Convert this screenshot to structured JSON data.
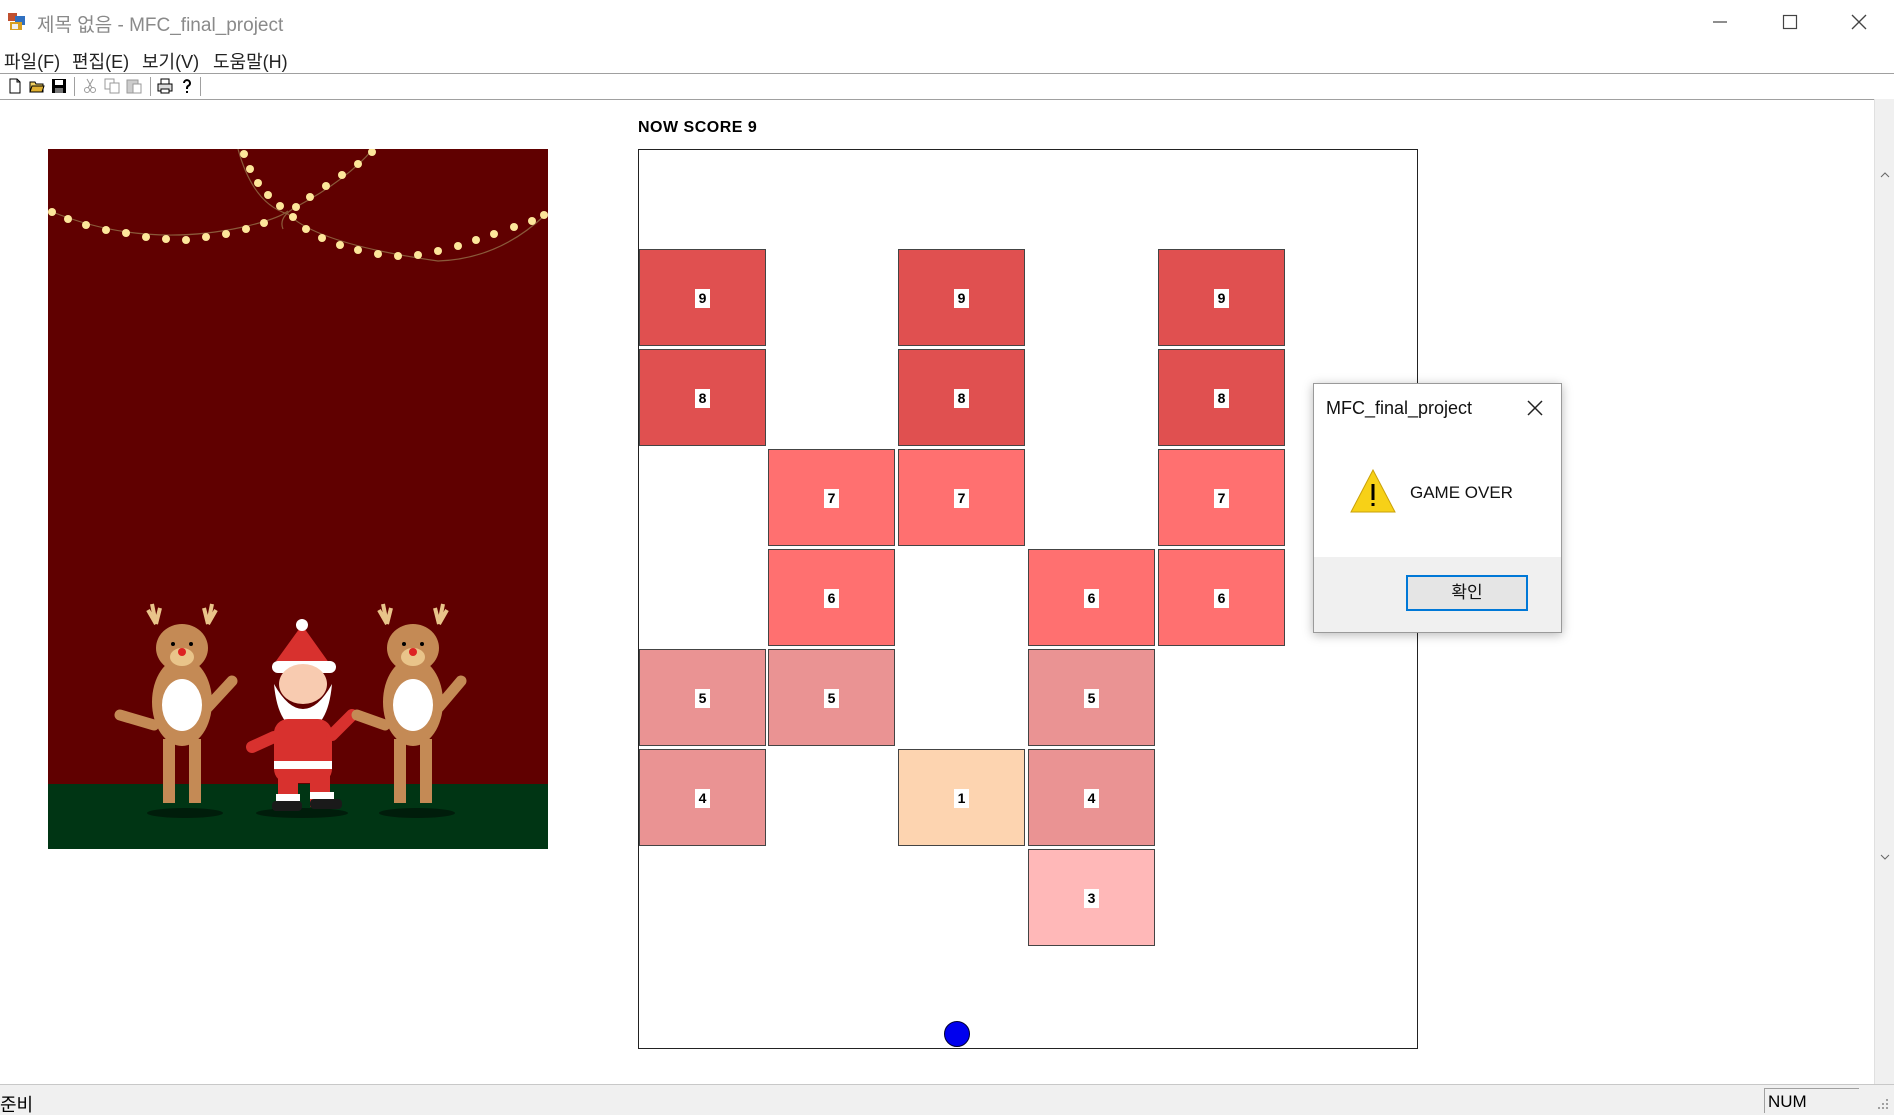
{
  "window": {
    "title": "제목 없음 - MFC_final_project",
    "icon": "mfc-app-icon"
  },
  "menu": [
    "파일(F)",
    "편집(E)",
    "보기(V)",
    "도움말(H)"
  ],
  "toolbar": {
    "icons": [
      "new-icon",
      "open-icon",
      "save-icon",
      "cut-icon",
      "copy-icon",
      "paste-icon",
      "print-icon",
      "help-icon"
    ]
  },
  "game": {
    "score_label": "NOW SCORE 9",
    "ball_color": "#0000ee",
    "bricks": [
      {
        "col": 0,
        "row": 0,
        "value": "9",
        "color": "#e05050"
      },
      {
        "col": 2,
        "row": 0,
        "value": "9",
        "color": "#e05050"
      },
      {
        "col": 4,
        "row": 0,
        "value": "9",
        "color": "#e05050"
      },
      {
        "col": 0,
        "row": 1,
        "value": "8",
        "color": "#e05050"
      },
      {
        "col": 2,
        "row": 1,
        "value": "8",
        "color": "#e05050"
      },
      {
        "col": 4,
        "row": 1,
        "value": "8",
        "color": "#e05050"
      },
      {
        "col": 1,
        "row": 2,
        "value": "7",
        "color": "#ff7070"
      },
      {
        "col": 2,
        "row": 2,
        "value": "7",
        "color": "#ff7070"
      },
      {
        "col": 4,
        "row": 2,
        "value": "7",
        "color": "#ff7070"
      },
      {
        "col": 1,
        "row": 3,
        "value": "6",
        "color": "#ff7070"
      },
      {
        "col": 3,
        "row": 3,
        "value": "6",
        "color": "#ff7070"
      },
      {
        "col": 4,
        "row": 3,
        "value": "6",
        "color": "#ff7070"
      },
      {
        "col": 0,
        "row": 4,
        "value": "5",
        "color": "#ea9393"
      },
      {
        "col": 1,
        "row": 4,
        "value": "5",
        "color": "#ea9393"
      },
      {
        "col": 3,
        "row": 4,
        "value": "5",
        "color": "#ea9393"
      },
      {
        "col": 0,
        "row": 5,
        "value": "4",
        "color": "#ea9393"
      },
      {
        "col": 2,
        "row": 5,
        "value": "1",
        "color": "#fdd4b0"
      },
      {
        "col": 3,
        "row": 5,
        "value": "4",
        "color": "#ea9393"
      },
      {
        "col": 3,
        "row": 6,
        "value": "3",
        "color": "#ffb8b8"
      }
    ]
  },
  "dialog": {
    "title": "MFC_final_project",
    "message": "GAME OVER",
    "ok_label": "확인",
    "icon": "warning-icon"
  },
  "status": {
    "text": "준비",
    "num": "NUM"
  }
}
